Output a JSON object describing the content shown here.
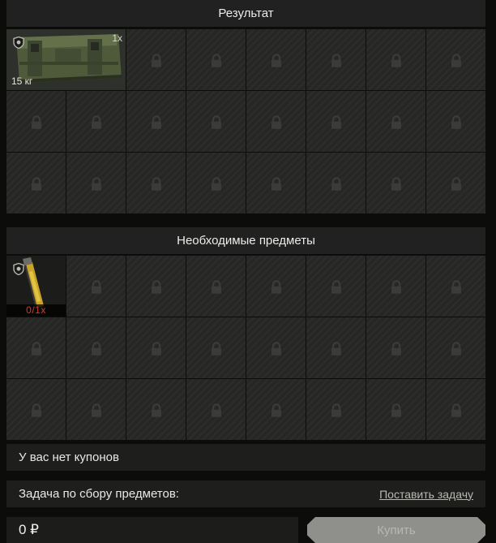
{
  "result_section": {
    "title": "Результат",
    "item": {
      "icon": "ammo-crate-icon",
      "quantity": "1x",
      "weight": "15 кг"
    },
    "locked_slot_icon": "lock-icon"
  },
  "required_section": {
    "title": "Необходимые предметы",
    "item": {
      "icon": "tool-handle-icon",
      "count": "0/1x"
    }
  },
  "coupons": {
    "text": "У вас нет купонов"
  },
  "task": {
    "label": "Задача по сбору предметов:",
    "link_label": "Поставить задачу"
  },
  "purchase": {
    "price": "0 ₽",
    "buy_label": "Купить"
  },
  "colors": {
    "background": "#0c0c0b",
    "slot": "#262725",
    "required_count": "#d03a2e",
    "buy_button": "#8f8f8b"
  }
}
